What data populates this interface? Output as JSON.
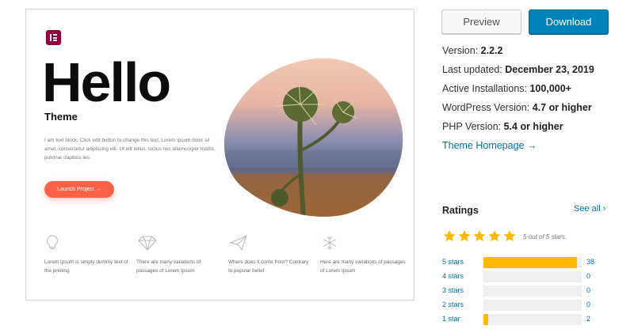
{
  "preview": {
    "hello": "Hello",
    "theme": "Theme",
    "lorem": "I am text block. Click edit button to change this text. Lorem ipsum dolor sit amet, consectetur adipiscing elit. Ut elit tellus, luctus nec ullamcorper mattis, pulvinar dapibus leo.",
    "launch_button": "Launch Project →",
    "features": [
      {
        "icon": "lightbulb-icon",
        "text": "Lorem Ipsum is simply dummy text of the printing"
      },
      {
        "icon": "diamond-icon",
        "text": "There are many variations of passages of Lorem Ipsum"
      },
      {
        "icon": "paper-plane-icon",
        "text": "Where does it come from? Contrary to popular belief"
      },
      {
        "icon": "snowflake-icon",
        "text": "Here are many variations of passages of Lorem Ipsum"
      }
    ]
  },
  "actions": {
    "preview_label": "Preview",
    "download_label": "Download"
  },
  "meta": {
    "version_label": "Version:",
    "version": "2.2.2",
    "updated_label": "Last updated:",
    "updated": "December 23, 2019",
    "installs_label": "Active Installations:",
    "installs": "100,000+",
    "wp_label": "WordPress Version:",
    "wp": "4.7 or higher",
    "php_label": "PHP Version:",
    "php": "5.4 or higher",
    "homepage_link": "Theme Homepage →"
  },
  "ratings": {
    "title": "Ratings",
    "see_all": "See all ›",
    "stars_filled": 5,
    "stars_text": "5 out of 5 stars.",
    "rows": [
      {
        "label": "5 stars",
        "count": "38",
        "fraction": 0.95
      },
      {
        "label": "4 stars",
        "count": "0",
        "fraction": 0
      },
      {
        "label": "3 stars",
        "count": "0",
        "fraction": 0
      },
      {
        "label": "2 stars",
        "count": "0",
        "fraction": 0
      },
      {
        "label": "1 star",
        "count": "2",
        "fraction": 0.05
      }
    ]
  },
  "colors": {
    "accent": "#0085ba",
    "link": "#0073aa",
    "launch": "#ff6146",
    "star": "#ffb900",
    "elementor": "#92003b"
  }
}
